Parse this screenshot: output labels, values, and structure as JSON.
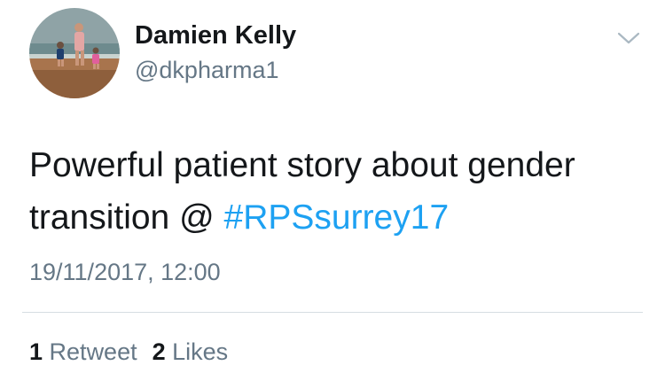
{
  "author": {
    "display_name": "Damien Kelly",
    "handle": "@dkpharma1",
    "avatar_icon": "user-avatar"
  },
  "menu_icon": "chevron-down-icon",
  "tweet": {
    "text_prefix": "Powerful patient story about gender transition @ ",
    "hashtag": "#RPSsurrey17",
    "timestamp": "19/11/2017, 12:00"
  },
  "stats": {
    "retweet_count": "1",
    "retweet_label": "Retweet",
    "like_count": "2",
    "like_label": "Likes"
  },
  "colors": {
    "link": "#1da1f2",
    "secondary_text": "#657786",
    "primary_text": "#14171a"
  }
}
